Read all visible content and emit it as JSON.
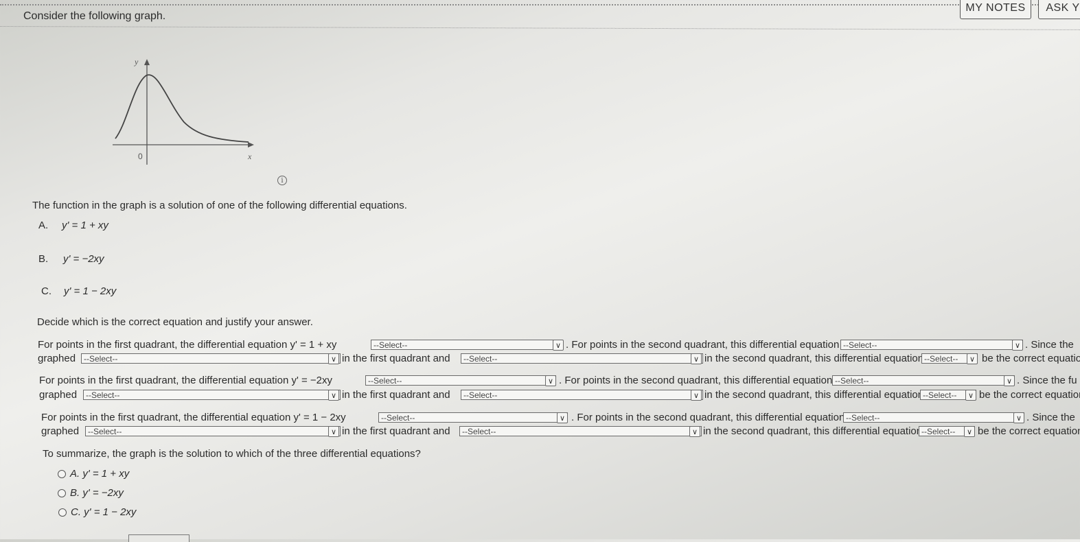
{
  "header": {
    "prompt": "Consider the following graph.",
    "my_notes_label": "MY NOTES",
    "ask_label": "ASK Y"
  },
  "graph": {
    "y_label": "y",
    "x_label": "x",
    "origin_label": "0"
  },
  "intro": "The function in the graph is a solution of one of the following differential equations.",
  "options": [
    {
      "letter": "A.",
      "eq": "y' = 1 + xy"
    },
    {
      "letter": "B.",
      "eq": "y' = −2xy"
    },
    {
      "letter": "C.",
      "eq": "y' = 1 − 2xy"
    }
  ],
  "decide": "Decide which is the correct equation and justify your answer.",
  "rows": [
    {
      "line1_prefix": "For points in the first quadrant, the differential equation y' = 1 + xy",
      "line1_mid": ". For points in the second quadrant, this differential equation",
      "line1_end": ". Since the",
      "graphed": "graphed",
      "line2_mid": "in the first quadrant and",
      "line2_mid2": "in the second quadrant, this differential equation",
      "line2_end": "be the correct equatio"
    },
    {
      "line1_prefix": "For points in the first quadrant, the differential equation y' = −2xy",
      "line1_mid": ". For points in the second quadrant, this differential equation",
      "line1_end": ". Since the fu",
      "graphed": "graphed",
      "line2_mid": "in the first quadrant and",
      "line2_mid2": "in the second quadrant, this differential equation",
      "line2_end": "be the correct equation"
    },
    {
      "line1_prefix": "For points in the first quadrant, the differential equation y' = 1 − 2xy",
      "line1_mid": ". For points in the second quadrant, this differential equation",
      "line1_end": ". Since the",
      "graphed": "graphed",
      "line2_mid": "in the first quadrant and",
      "line2_mid2": "in the second quadrant, this differential equation",
      "line2_end": "be the correct equation"
    }
  ],
  "select_placeholder": "--Select--",
  "select_short": "Select",
  "summary": {
    "question": "To summarize, the graph is the solution to which of the three differential equations?",
    "choices": [
      "A. y' = 1 + xy",
      "B. y' = −2xy",
      "C. y' = 1 − 2xy"
    ]
  }
}
